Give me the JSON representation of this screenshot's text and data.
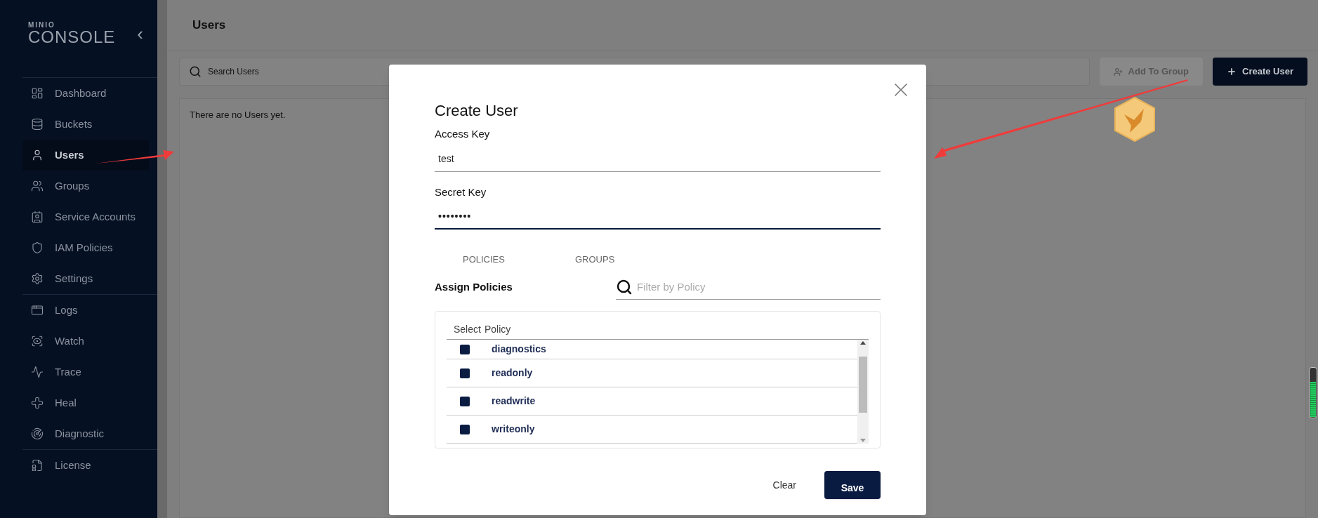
{
  "sidebar": {
    "logo_top": "MINIO",
    "logo_bottom": "CONSOLE",
    "collapse": "‹",
    "sections": [
      {
        "items": [
          {
            "label": "Dashboard",
            "selected": false
          },
          {
            "label": "Buckets",
            "selected": false
          },
          {
            "label": "Users",
            "selected": true
          },
          {
            "label": "Groups",
            "selected": false
          },
          {
            "label": "Service Accounts",
            "selected": false
          },
          {
            "label": "IAM Policies",
            "selected": false
          },
          {
            "label": "Settings",
            "selected": false
          }
        ]
      },
      {
        "items": [
          {
            "label": "Logs",
            "selected": false
          },
          {
            "label": "Watch",
            "selected": false
          },
          {
            "label": "Trace",
            "selected": false
          },
          {
            "label": "Heal",
            "selected": false
          },
          {
            "label": "Diagnostic",
            "selected": false
          }
        ]
      },
      {
        "items": [
          {
            "label": "License",
            "selected": false
          }
        ]
      }
    ]
  },
  "page": {
    "title": "Users",
    "search": {
      "placeholder": "Search Users"
    },
    "buttons": [
      {
        "label": "Add To Group",
        "kind": "secondary"
      },
      {
        "label": "Create User",
        "kind": "primary"
      }
    ],
    "empty_message": "There are no Users yet."
  },
  "dialog": {
    "title": "Create User",
    "fields": [
      {
        "label": "Access Key",
        "value": "test",
        "focused": false
      },
      {
        "label": "Secret Key",
        "value": "••••••••",
        "focused": true
      }
    ],
    "tabs": [
      {
        "label": "POLICIES"
      },
      {
        "label": "GROUPS"
      }
    ],
    "section_title": "Assign Policies",
    "filter": {
      "placeholder": "Filter by Policy"
    },
    "table": {
      "columns": [
        "Select",
        "Policy"
      ],
      "rows": [
        {
          "policy": "diagnostics",
          "checked": false
        },
        {
          "policy": "readonly",
          "checked": false
        },
        {
          "policy": "readwrite",
          "checked": false
        },
        {
          "policy": "writeonly",
          "checked": false
        }
      ]
    },
    "buttons": [
      {
        "label": "Clear",
        "kind": "text"
      },
      {
        "label": "Save",
        "kind": "primary"
      }
    ]
  }
}
